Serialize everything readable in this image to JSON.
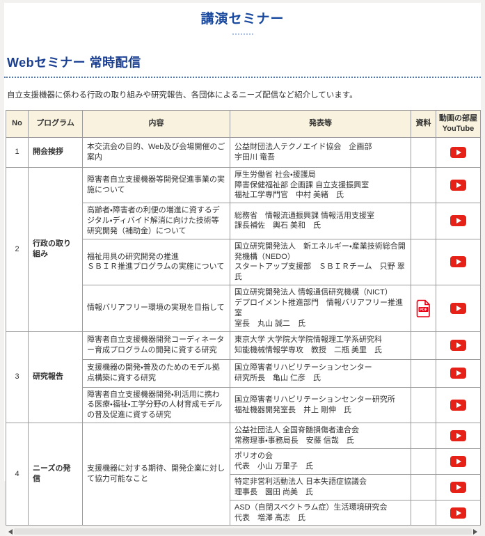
{
  "page": {
    "title": "講演セミナー",
    "section_heading": "Webセミナー 常時配信",
    "description": "自立支援機器に係わる行政の取り組みや研究報告、各団体によるニーズ配信など紹介しています。"
  },
  "colors": {
    "title_blue": "#17489e",
    "heading_blue": "#1a3f92",
    "table_header_bg": "#f8f2de",
    "table_border": "#9a9a9a",
    "youtube_red": "#e62117",
    "pdf_red": "#e60012"
  },
  "icons": {
    "youtube": "youtube-play-icon",
    "pdf": "pdf-file-icon",
    "pdf_label": "PDF"
  },
  "table": {
    "headers": {
      "no": "No",
      "program": "プログラム",
      "content": "内容",
      "presenter": "発表等",
      "document": "資料",
      "video": "動画の部屋\nYouTube"
    },
    "groups": [
      {
        "no": "1",
        "program": "開会挨拶",
        "rows": [
          {
            "content": "本交流会の目的、Web及び会場開催のご案内",
            "presenter": "公益財団法人テクノエイド協会　企画部\n宇田川 竜吾"
          }
        ]
      },
      {
        "no": "2",
        "program": "行政の取り組み",
        "rows": [
          {
            "content": "障害者自立支援機器等開発促進事業の実施について",
            "presenter": "厚生労働省 社会・援護局\n障害保健福祉部 企画課 自立支援振興室\n福祉工学専門官　中村 美緒　氏"
          },
          {
            "content": "高齢者・障害者の利便の増進に資するデジタル・ディバイド解消に向けた技術等研究開発（補助金）について",
            "presenter": "総務省　情報流通振興課 情報活用支援室\n課長補佐　輿石 美和　氏"
          },
          {
            "content": "福祉用具の研究開発の推進\nＳＢＩＲ推進プログラムの実施について",
            "presenter": "国立研究開発法人　新エネルギー・産業技術総合開発機構（NEDO）\nスタートアップ支援部　ＳＢＩＲチーム　只野 翠　氏"
          },
          {
            "content": "情報バリアフリー環境の実現を目指して",
            "presenter": "国立研究開発法人 情報通信研究機構（NICT）\nデプロイメント推進部門　情報バリアフリー推進室\n室長　丸山 誠二　氏"
          }
        ]
      },
      {
        "no": "3",
        "program": "研究報告",
        "rows": [
          {
            "content": "障害者自立支援機器開発コーディネーター育成プログラムの開発に資する研究",
            "presenter": "東京大学 大学院大学院情報理工学系研究科\n知能機械情報学専攻　教授　二瓶 美里　氏"
          },
          {
            "content": "支援機器の開発・普及のためのモデル拠点構築に資する研究",
            "presenter": "国立障害者リハビリテーションセンター\n研究所長　亀山 仁彦　氏"
          },
          {
            "content": "障害者自立支援機器開発・利活用に携わる医療・福祉・工学分野の人材育成モデルの普及促進に資する研究",
            "presenter": "国立障害者リハビリテーションセンター研究所\n福祉機器開発室長　井上 剛伸　氏"
          }
        ]
      },
      {
        "no": "4",
        "program": "ニーズの発信",
        "shared_content": "支援機器に対する期待、開発企業に対して協力可能なこと",
        "rows": [
          {
            "presenter": "公益社団法人 全国脊髄損傷者連合会\n常務理事・事務局長　安藤 信哉　氏"
          },
          {
            "presenter": "ポリオの会\n代表　小山 万里子　氏"
          },
          {
            "presenter": "特定非営利活動法人 日本失語症協議会\n理事長　園田 尚美　氏"
          },
          {
            "presenter": "ASD（自閉スペクトラム症）生活環境研究会\n代表　増澤 高志　氏"
          }
        ]
      }
    ]
  }
}
